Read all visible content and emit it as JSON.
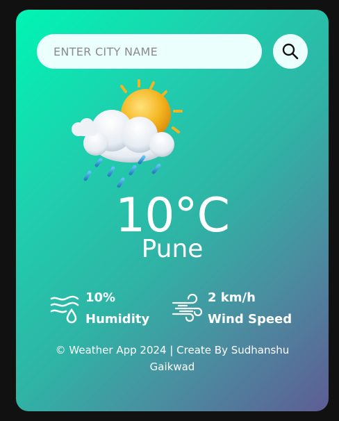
{
  "search": {
    "placeholder": "ENTER CITY NAME",
    "button_icon": "search-icon"
  },
  "weather": {
    "icon": "sun-behind-rain-cloud-icon",
    "temperature": "10°C",
    "city": "Pune"
  },
  "details": {
    "humidity": {
      "icon": "humidity-icon",
      "value": "10%",
      "label": "Humidity"
    },
    "wind": {
      "icon": "wind-icon",
      "value": "2 km/h",
      "label": "Wind Speed"
    }
  },
  "footer": {
    "text": "© Weather App 2024 | Create By Sudhanshu Gaikwad"
  },
  "colors": {
    "gradient_start": "#00f5b4",
    "gradient_end": "#5e5d94",
    "input_bg": "#ebfffc"
  }
}
